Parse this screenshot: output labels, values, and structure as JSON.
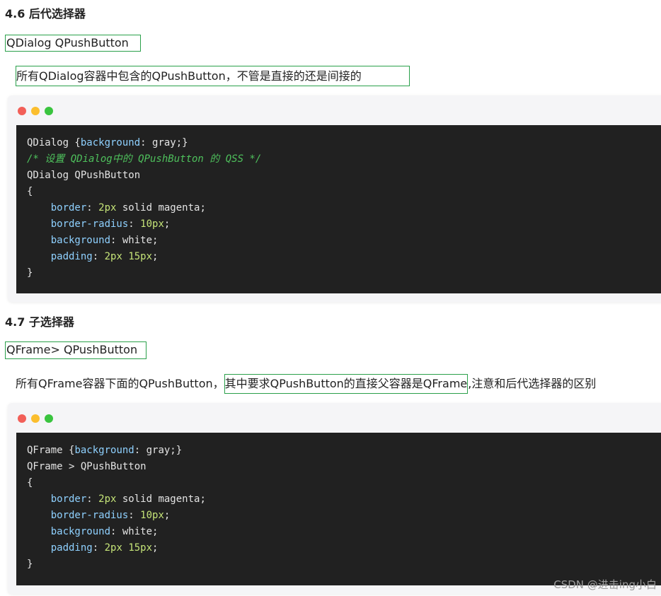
{
  "section1": {
    "title": "4.6 后代选择器",
    "selector": "QDialog QPushButton",
    "description": "所有QDialog容器中包含的QPushButton，不管是直接的还是间接的",
    "code": [
      [
        {
          "t": "QDialog {"
        },
        {
          "t": "background",
          "k": "kw"
        },
        {
          "t": ": gray;}"
        }
      ],
      [
        {
          "t": "/* 设置 QDialog中的 QPushButton 的 QSS */",
          "k": "cm"
        }
      ],
      [
        {
          "t": "QDialog QPushButton"
        }
      ],
      [
        {
          "t": "{"
        }
      ],
      [
        {
          "t": "    "
        },
        {
          "t": "border",
          "k": "kw"
        },
        {
          "t": ": "
        },
        {
          "t": "2px",
          "k": "num"
        },
        {
          "t": " solid magenta;"
        }
      ],
      [
        {
          "t": "    "
        },
        {
          "t": "border-radius",
          "k": "kw"
        },
        {
          "t": ": "
        },
        {
          "t": "10px",
          "k": "num"
        },
        {
          "t": ";"
        }
      ],
      [
        {
          "t": "    "
        },
        {
          "t": "background",
          "k": "kw"
        },
        {
          "t": ": white;"
        }
      ],
      [
        {
          "t": "    "
        },
        {
          "t": "padding",
          "k": "kw"
        },
        {
          "t": ": "
        },
        {
          "t": "2px",
          "k": "num"
        },
        {
          "t": " "
        },
        {
          "t": "15px",
          "k": "num"
        },
        {
          "t": ";"
        }
      ],
      [
        {
          "t": "}"
        }
      ]
    ]
  },
  "section2": {
    "title": "4.7 子选择器",
    "selector": "QFrame> QPushButton",
    "description_before": "所有QFrame容器下面的QPushButton，",
    "description_boxed": "其中要求QPushButton的直接父容器是QFrame",
    "description_after": ",注意和后代选择器的区别",
    "code": [
      [
        {
          "t": "QFrame {"
        },
        {
          "t": "background",
          "k": "kw"
        },
        {
          "t": ": gray;}"
        }
      ],
      [
        {
          "t": "QFrame > QPushButton"
        }
      ],
      [
        {
          "t": "{"
        }
      ],
      [
        {
          "t": "    "
        },
        {
          "t": "border",
          "k": "kw"
        },
        {
          "t": ": "
        },
        {
          "t": "2px",
          "k": "num"
        },
        {
          "t": " solid magenta;"
        }
      ],
      [
        {
          "t": "    "
        },
        {
          "t": "border-radius",
          "k": "kw"
        },
        {
          "t": ": "
        },
        {
          "t": "10px",
          "k": "num"
        },
        {
          "t": ";"
        }
      ],
      [
        {
          "t": "    "
        },
        {
          "t": "background",
          "k": "kw"
        },
        {
          "t": ": white;"
        }
      ],
      [
        {
          "t": "    "
        },
        {
          "t": "padding",
          "k": "kw"
        },
        {
          "t": ": "
        },
        {
          "t": "2px",
          "k": "num"
        },
        {
          "t": " "
        },
        {
          "t": "15px",
          "k": "num"
        },
        {
          "t": ";"
        }
      ],
      [
        {
          "t": "}"
        }
      ]
    ]
  },
  "window_dots": {
    "close_color": "#f25f58",
    "minimize_color": "#fbbe2e",
    "maximize_color": "#3ac43f"
  },
  "watermark": "CSDN @进击ing小白"
}
